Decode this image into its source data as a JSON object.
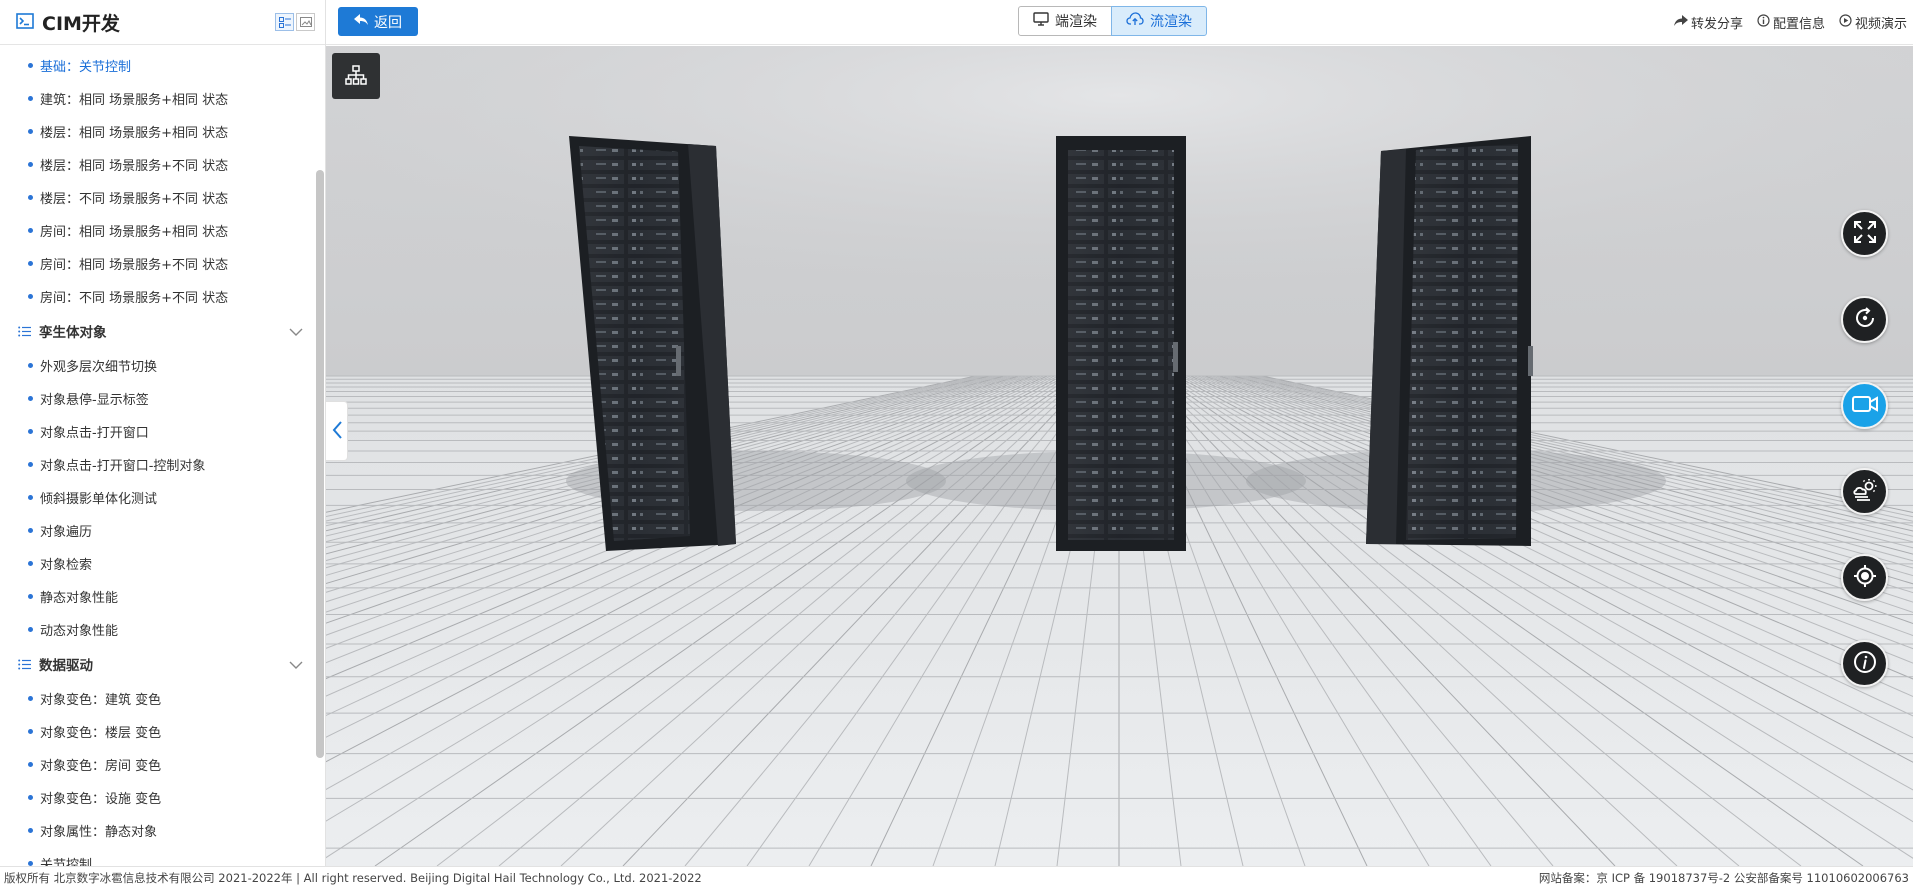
{
  "app": {
    "title": "CIM开发"
  },
  "sidebar": {
    "items_top": [
      {
        "label": "基础：关节控制",
        "active": true
      },
      {
        "label": "建筑：相同 场景服务+相同 状态"
      },
      {
        "label": "楼层：相同 场景服务+相同 状态"
      },
      {
        "label": "楼层：相同 场景服务+不同 状态"
      },
      {
        "label": "楼层：不同 场景服务+不同 状态"
      },
      {
        "label": "房间：相同 场景服务+相同 状态"
      },
      {
        "label": "房间：相同 场景服务+不同 状态"
      },
      {
        "label": "房间：不同 场景服务+不同 状态"
      }
    ],
    "group1": {
      "label": "孪生体对象"
    },
    "items_twin": [
      {
        "label": "外观多层次细节切换"
      },
      {
        "label": "对象悬停-显示标签"
      },
      {
        "label": "对象点击-打开窗口"
      },
      {
        "label": "对象点击-打开窗口-控制对象"
      },
      {
        "label": "倾斜摄影单体化测试"
      },
      {
        "label": "对象遍历"
      },
      {
        "label": "对象检索"
      },
      {
        "label": "静态对象性能"
      },
      {
        "label": "动态对象性能"
      }
    ],
    "group2": {
      "label": "数据驱动"
    },
    "items_data": [
      {
        "label": "对象变色：建筑 变色"
      },
      {
        "label": "对象变色：楼层 变色"
      },
      {
        "label": "对象变色：房间 变色"
      },
      {
        "label": "对象变色：设施 变色"
      },
      {
        "label": "对象属性：静态对象"
      },
      {
        "label": "关节控制"
      }
    ]
  },
  "topbar": {
    "back_label": "返回",
    "render_client": "端渲染",
    "render_stream": "流渲染",
    "share": "转发分享",
    "config": "配置信息",
    "video": "视频演示"
  },
  "viewport": {
    "tools": [
      "fullscreen-icon",
      "rotate-icon",
      "camera-record-icon",
      "weather-icon",
      "locate-icon",
      "info-icon"
    ],
    "active_tool": "camera-record-icon"
  },
  "footer": {
    "copyright": "版权所有 北京数字冰雹信息技术有限公司 2021-2022年 | All right reserved. Beijing Digital Hail Technology Co., Ltd. 2021-2022",
    "icp": "网站备案：京 ICP 备 19018737号-2 公安部备案号 11010602006763"
  },
  "colors": {
    "accent": "#1e7ad6",
    "active_tool": "#1aa2e8",
    "dark_button": "#1f2123"
  }
}
